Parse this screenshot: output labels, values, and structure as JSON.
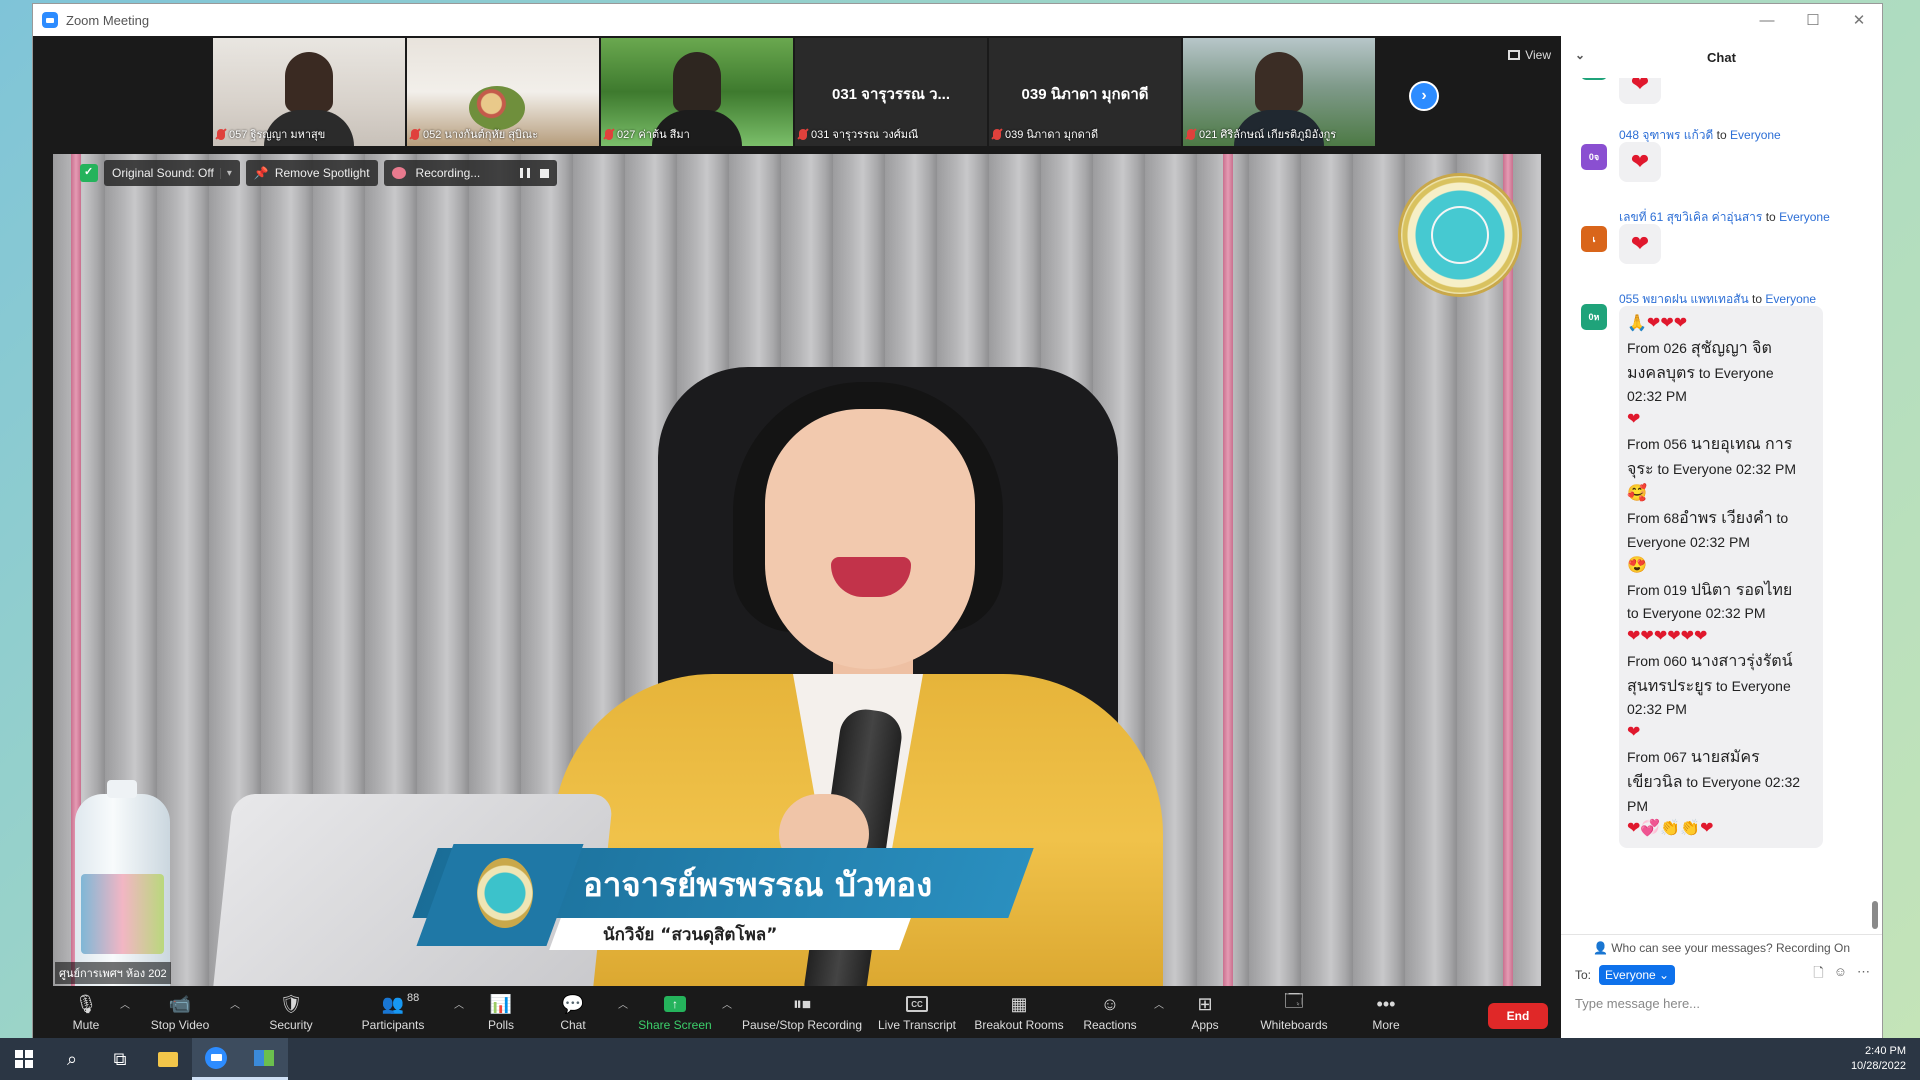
{
  "window": {
    "title": "Zoom Meeting",
    "controls": [
      "—",
      "☐",
      "✕"
    ]
  },
  "thumbnails": [
    {
      "name": "057 ฐิรญญา มหาสุข",
      "center": ""
    },
    {
      "name": "052 นางกันต์กุหัย สุบิณะ",
      "center": ""
    },
    {
      "name": "027 ค่าต้น สีมา",
      "center": ""
    },
    {
      "name": "031 จารุวรรณ  วงศ์มณี",
      "center": "031 จารุวรรณ  ว..."
    },
    {
      "name": "039 นิภาดา มุกดาดี",
      "center": "039 นิภาดา มุกดาดี"
    },
    {
      "name": "021 ศิริลักษณ์ เกียรติภูมิอังกูร",
      "center": ""
    }
  ],
  "view_label": "View",
  "main_video": {
    "pills": {
      "sound": "Original Sound: Off",
      "spotlight": "Remove Spotlight",
      "recording": "Recording..."
    },
    "speaker_name": "อาจารย์พรพรรณ บัวทอง",
    "speaker_role": "นักวิจัย “สวนดุสิตโพล”",
    "name_tag": "ศูนย์การเพศฯ ห้อง 202"
  },
  "toolbar": {
    "mute": "Mute",
    "stop_video": "Stop Video",
    "security": "Security",
    "participants": "Participants",
    "participants_count": "88",
    "polls": "Polls",
    "chat": "Chat",
    "share_screen": "Share Screen",
    "pause_stop_recording": "Pause/Stop Recording",
    "live_transcript": "Live Transcript",
    "breakout_rooms": "Breakout Rooms",
    "reactions": "Reactions",
    "apps": "Apps",
    "whiteboards": "Whiteboards",
    "more": "More",
    "end": "End"
  },
  "chat": {
    "title": "Chat",
    "messages": [
      {
        "sender": "048 จุฑาพร  แก้วดี",
        "to": "to",
        "recipient": "Everyone",
        "avatar": "0จ",
        "avatar_color": "#8a4fd1",
        "content": "❤"
      },
      {
        "sender": "เลขที่ 61 สุขวิเคิล ค่าอุ่นสาร",
        "to": "to",
        "recipient": "Everyone",
        "avatar": "เ",
        "avatar_color": "#d9651a",
        "content": "❤"
      },
      {
        "sender": "055 พยาดฝน แพทเทอสัน",
        "to": "to",
        "recipient": "Everyone",
        "avatar": "0ห",
        "avatar_color": "#1fa37a"
      }
    ],
    "big_bubble": {
      "line1": "🙏❤❤❤",
      "m1": {
        "prefix": "From 026 ",
        "name": "สุชัญญา จิต",
        "name2": "มงคลบุตร",
        "suffix": " to Everyone",
        "time": "02:32 PM",
        "emoji": "❤"
      },
      "m2": {
        "prefix": "From 056 ",
        "name": "นายอุเทณ การ",
        "name2": "จุระ",
        "suffix": " to Everyone 02:32 PM",
        "emoji": "🥰"
      },
      "m3": {
        "prefix": "From 68",
        "name": "อำพร  เวียงคำ",
        "suffix": " to",
        "suffix2": "Everyone 02:32 PM",
        "emoji": "😍"
      },
      "m4": {
        "prefix": "From 019 ",
        "name": "ปนิตา  รอดไทย",
        "suffix": "to Everyone 02:32 PM",
        "emoji": "❤❤❤❤❤❤"
      },
      "m5": {
        "prefix": "From 060 ",
        "name": "นางสาวรุ่งรัตน์",
        "name2": "สุนทรประยูร",
        "suffix": " to Everyone",
        "time": "02:32 PM",
        "emoji": "❤"
      },
      "m6": {
        "prefix": "From 067 ",
        "name": "นายสมัคร",
        "name2": "เขียวนิล",
        "suffix": " to Everyone 02:32",
        "suffix2": "PM",
        "emoji": "❤💞👏👏❤"
      }
    },
    "who_can_see": "Who can see your messages? Recording On",
    "to_label": "To:",
    "to_value": "Everyone ⌄",
    "placeholder": "Type message here..."
  },
  "taskbar": {
    "time": "2:40 PM",
    "date": "10/28/2022"
  }
}
